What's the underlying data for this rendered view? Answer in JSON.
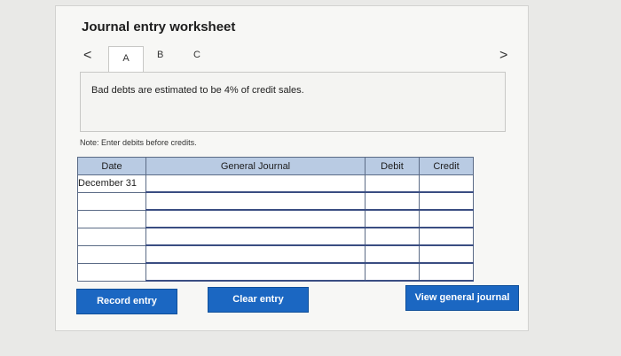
{
  "worksheet": {
    "title": "Journal entry worksheet",
    "tabs": [
      {
        "label": "A"
      },
      {
        "label": "B"
      },
      {
        "label": "C"
      }
    ],
    "nav_prev": "<",
    "nav_next": ">",
    "description": "Bad debts are estimated to be 4% of credit sales.",
    "note": "Note: Enter debits before credits."
  },
  "table": {
    "headers": {
      "date": "Date",
      "general_journal": "General Journal",
      "debit": "Debit",
      "credit": "Credit"
    },
    "rows": [
      {
        "date": "December 31",
        "account": "",
        "debit": "",
        "credit": ""
      },
      {
        "date": "",
        "account": "",
        "debit": "",
        "credit": ""
      },
      {
        "date": "",
        "account": "",
        "debit": "",
        "credit": ""
      },
      {
        "date": "",
        "account": "",
        "debit": "",
        "credit": ""
      },
      {
        "date": "",
        "account": "",
        "debit": "",
        "credit": ""
      },
      {
        "date": "",
        "account": "",
        "debit": "",
        "credit": ""
      }
    ]
  },
  "buttons": {
    "record": "Record entry",
    "clear": "Clear entry",
    "view": "View general journal"
  },
  "colors": {
    "accent": "#1b67c2",
    "header_bg": "#b9cbe3"
  }
}
